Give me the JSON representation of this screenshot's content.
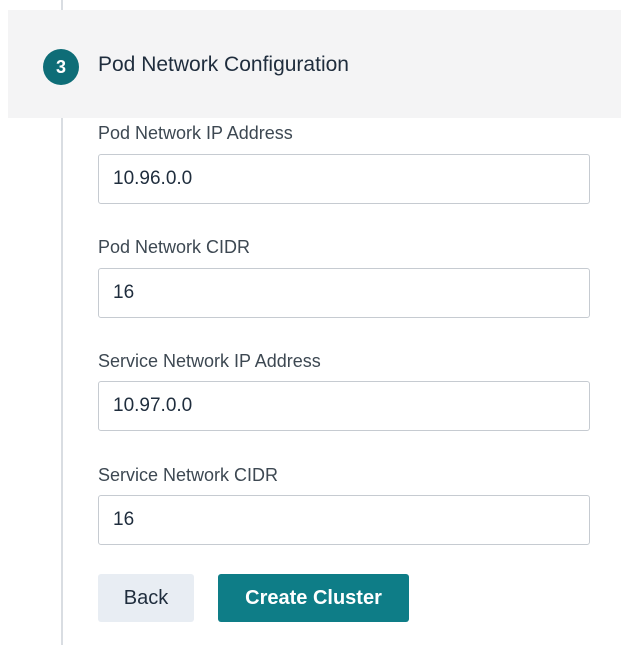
{
  "step": {
    "number": "3",
    "title": "Pod Network Configuration"
  },
  "fields": [
    {
      "label": "Pod Network IP Address",
      "value": "10.96.0.0"
    },
    {
      "label": "Pod Network CIDR",
      "value": "16"
    },
    {
      "label": "Service Network IP Address",
      "value": "10.97.0.0"
    },
    {
      "label": "Service Network CIDR",
      "value": "16"
    }
  ],
  "actions": {
    "back_label": "Back",
    "create_label": "Create Cluster"
  },
  "colors": {
    "accent": "#0e7d87",
    "badge": "#0e6d77",
    "header_bg": "#f4f4f5",
    "back_bg": "#e8edf3"
  }
}
